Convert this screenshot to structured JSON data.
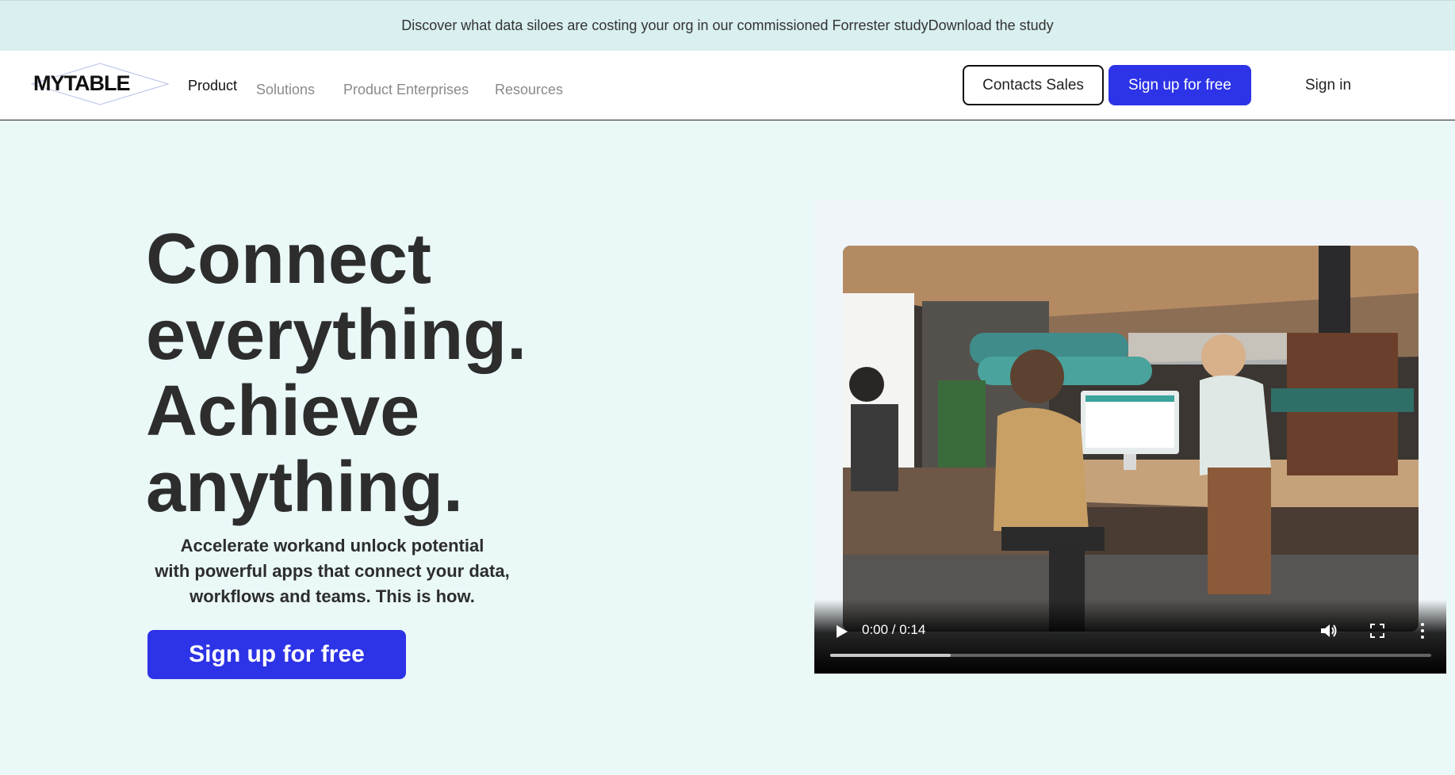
{
  "announcement": {
    "text": "Discover what data siloes are costing your org in our commissioned Forrester study",
    "link": "Download the study"
  },
  "nav": {
    "logo": "MYTABLE",
    "links": [
      "Product",
      "Solutions",
      "Product Enterprises",
      "Resources"
    ],
    "contact_sales": "Contacts Sales",
    "signup": "Sign up for free",
    "signin": "Sign in"
  },
  "hero": {
    "title_lines": [
      "Connect",
      "everything.",
      "Achieve",
      "anything."
    ],
    "subtitle_lines": [
      "Accelerate workand unlock potential",
      "with powerful apps that connect your data,",
      "workflows and teams. This is how."
    ],
    "cta": "Sign up for free"
  },
  "video": {
    "time": "0:00 / 0:14",
    "progress": 0.2
  },
  "colors": {
    "accent": "#2d33e6",
    "background": "#eaf8f8",
    "announcement_bg": "#d9eff0"
  }
}
